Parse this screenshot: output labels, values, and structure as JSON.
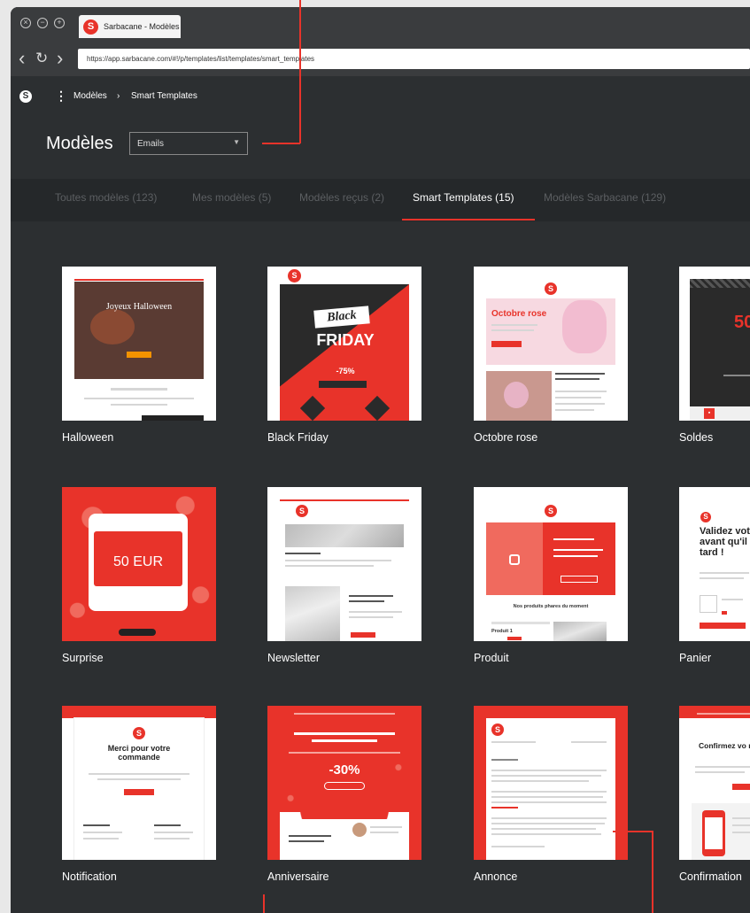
{
  "browser": {
    "tab_title": "Sarbacane - Modèles",
    "url": "https://app.sarbacane.com/#!/p/templates/list/templates/smart_templates",
    "back_icon": "‹",
    "reload_icon": "↻",
    "forward_icon": "›"
  },
  "app": {
    "logo": "S",
    "menu_icon": "⋮",
    "breadcrumb": [
      "Modèles",
      "Smart Templates"
    ],
    "breadcrumb_sep": "›"
  },
  "header": {
    "title": "Modèles",
    "select_value": "Emails",
    "select_caret": "▼"
  },
  "tabs": [
    {
      "label": "Toutes modèles (123)",
      "active": false
    },
    {
      "label": "Mes modèles (5)",
      "active": false
    },
    {
      "label": "Modèles reçus (2)",
      "active": false
    },
    {
      "label": "Smart Templates (15)",
      "active": true
    },
    {
      "label": "Modèles Sarbacane (129)",
      "active": false
    }
  ],
  "templates": [
    {
      "name": "Halloween",
      "thumb_title": "Joyeux Halloween"
    },
    {
      "name": "Black Friday",
      "thumb_title": "Black",
      "thumb_subtitle": "FRIDAY",
      "thumb_promo": "-75%"
    },
    {
      "name": "Octobre rose",
      "thumb_title": "Octobre rose"
    },
    {
      "name": "Soldes",
      "thumb_title": "50"
    },
    {
      "name": "Surprise",
      "thumb_title": "50 EUR"
    },
    {
      "name": "Newsletter"
    },
    {
      "name": "Produit",
      "thumb_subtitle": "Nos produits phares du moment",
      "thumb_item": "Produit 1"
    },
    {
      "name": "Panier",
      "thumb_title": "Validez vot avant qu'il tard !"
    },
    {
      "name": "Notification",
      "thumb_title": "Merci pour votre commande"
    },
    {
      "name": "Anniversaire",
      "thumb_promo": "-30%"
    },
    {
      "name": "Annonce"
    },
    {
      "name": "Confirmation",
      "thumb_title": "Confirmez vo notre c"
    }
  ],
  "colors": {
    "accent": "#e8332a",
    "background": "#2c2f31",
    "tabbar": "#25282a"
  }
}
